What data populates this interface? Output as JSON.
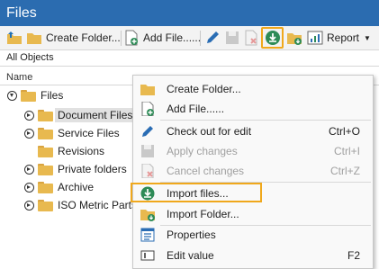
{
  "window": {
    "title": "Files"
  },
  "toolbar": {
    "create_folder_label": "Create Folder...",
    "add_file_label": "Add File......",
    "report_label": "Report"
  },
  "filter": {
    "text": "All Objects"
  },
  "tree": {
    "column_header": "Name",
    "root_label": "Files",
    "items": [
      {
        "label": "Document Files",
        "expandable": true,
        "selected": true
      },
      {
        "label": "Service Files",
        "expandable": true,
        "selected": false
      },
      {
        "label": "Revisions",
        "expandable": false,
        "selected": false
      },
      {
        "label": "Private folders",
        "expandable": true,
        "selected": false
      },
      {
        "label": "Archive",
        "expandable": true,
        "selected": false
      },
      {
        "label": "ISO Metric Parts",
        "expandable": true,
        "selected": false
      }
    ]
  },
  "context_menu": {
    "items": [
      {
        "label": "Create Folder...",
        "icon": "folder-icon",
        "shortcut": "",
        "disabled": false
      },
      {
        "label": "Add File......",
        "icon": "add-file-icon",
        "shortcut": "",
        "disabled": false
      },
      {
        "label": "Check out for edit",
        "icon": "pencil-icon",
        "shortcut": "Ctrl+O",
        "disabled": false
      },
      {
        "label": "Apply changes",
        "icon": "save-icon",
        "shortcut": "Ctrl+I",
        "disabled": true
      },
      {
        "label": "Cancel changes",
        "icon": "cancel-icon",
        "shortcut": "Ctrl+Z",
        "disabled": true
      },
      {
        "label": "Import files...",
        "icon": "import-icon",
        "shortcut": "",
        "disabled": false,
        "highlighted": true
      },
      {
        "label": "Import Folder...",
        "icon": "import-folder-icon",
        "shortcut": "",
        "disabled": false
      },
      {
        "label": "Properties",
        "icon": "properties-icon",
        "shortcut": "",
        "disabled": false
      },
      {
        "label": "Edit value",
        "icon": "edit-value-icon",
        "shortcut": "F2",
        "disabled": false
      }
    ]
  },
  "colors": {
    "title_bar": "#2b6cb0",
    "highlight_outline": "#f0a81c",
    "folder": "#e8b94f",
    "import_green": "#2e8b57"
  }
}
